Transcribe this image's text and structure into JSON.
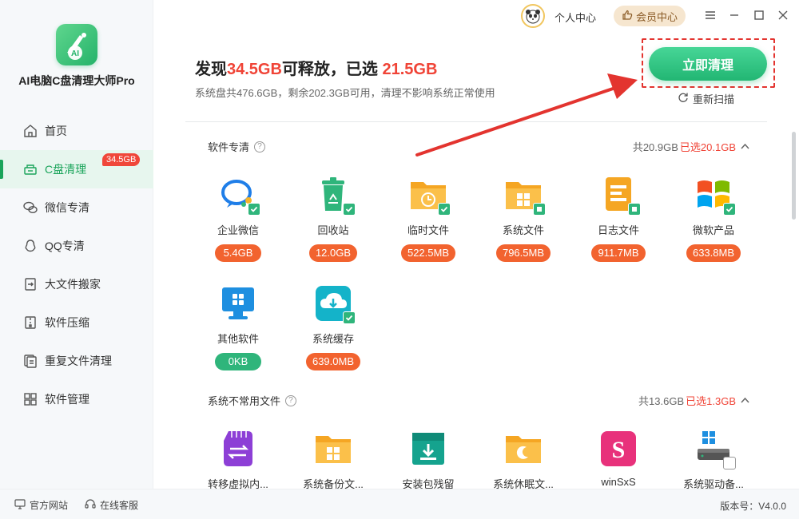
{
  "app": {
    "name": "AI电脑C盘清理大师Pro",
    "logo_text": "AI"
  },
  "topbar": {
    "personal": "个人中心",
    "vip": "会员中心"
  },
  "sidebar": {
    "items": [
      {
        "label": "首页",
        "icon": "home-icon"
      },
      {
        "label": "C盘清理",
        "icon": "drive-clean-icon",
        "badge": "34.5GB",
        "active": true
      },
      {
        "label": "微信专清",
        "icon": "wechat-icon"
      },
      {
        "label": "QQ专清",
        "icon": "qq-icon"
      },
      {
        "label": "大文件搬家",
        "icon": "file-move-icon"
      },
      {
        "label": "软件压缩",
        "icon": "compress-icon"
      },
      {
        "label": "重复文件清理",
        "icon": "duplicate-icon"
      },
      {
        "label": "软件管理",
        "icon": "apps-icon"
      }
    ]
  },
  "header": {
    "prefix": "发现",
    "found": "34.5GB",
    "mid": "可释放，已选 ",
    "selected": "21.5GB",
    "subline": "系统盘共476.6GB，剩余202.3GB可用，清理不影响系统正常使用",
    "clean_button": "立即清理",
    "rescan": "重新扫描"
  },
  "sections": [
    {
      "title": "软件专清",
      "total": "共20.9GB",
      "selected": "已选20.1GB",
      "items": [
        {
          "label": "企业微信",
          "size": "5.4GB",
          "icon": "enterprise-wechat-icon"
        },
        {
          "label": "回收站",
          "size": "12.0GB",
          "icon": "recycle-bin-icon"
        },
        {
          "label": "临时文件",
          "size": "522.5MB",
          "icon": "temp-folder-icon"
        },
        {
          "label": "系统文件",
          "size": "796.5MB",
          "icon": "system-folder-icon"
        },
        {
          "label": "日志文件",
          "size": "911.7MB",
          "icon": "log-file-icon"
        },
        {
          "label": "微软产品",
          "size": "633.8MB",
          "icon": "microsoft-icon"
        },
        {
          "label": "其他软件",
          "size": "0KB",
          "icon": "other-software-icon"
        },
        {
          "label": "系统缓存",
          "size": "639.0MB",
          "icon": "system-cache-icon"
        }
      ]
    },
    {
      "title": "系统不常用文件",
      "total": "共13.6GB",
      "selected": "已选1.3GB",
      "items": [
        {
          "label": "转移虚拟内...",
          "icon": "virtual-memory-icon"
        },
        {
          "label": "系统备份文...",
          "icon": "backup-folder-icon"
        },
        {
          "label": "安装包残留",
          "icon": "installer-icon"
        },
        {
          "label": "系统休眠文...",
          "icon": "hibernate-folder-icon"
        },
        {
          "label": "winSxS",
          "icon": "winsxs-icon",
          "letter": "S"
        },
        {
          "label": "系统驱动备...",
          "icon": "driver-backup-icon"
        }
      ]
    }
  ],
  "footer": {
    "website": "官方网站",
    "service": "在线客服",
    "version": "版本号：V4.0.0"
  },
  "colors": {
    "accent": "#22b673",
    "danger": "#f04437",
    "size_pill": "#f2632f"
  }
}
